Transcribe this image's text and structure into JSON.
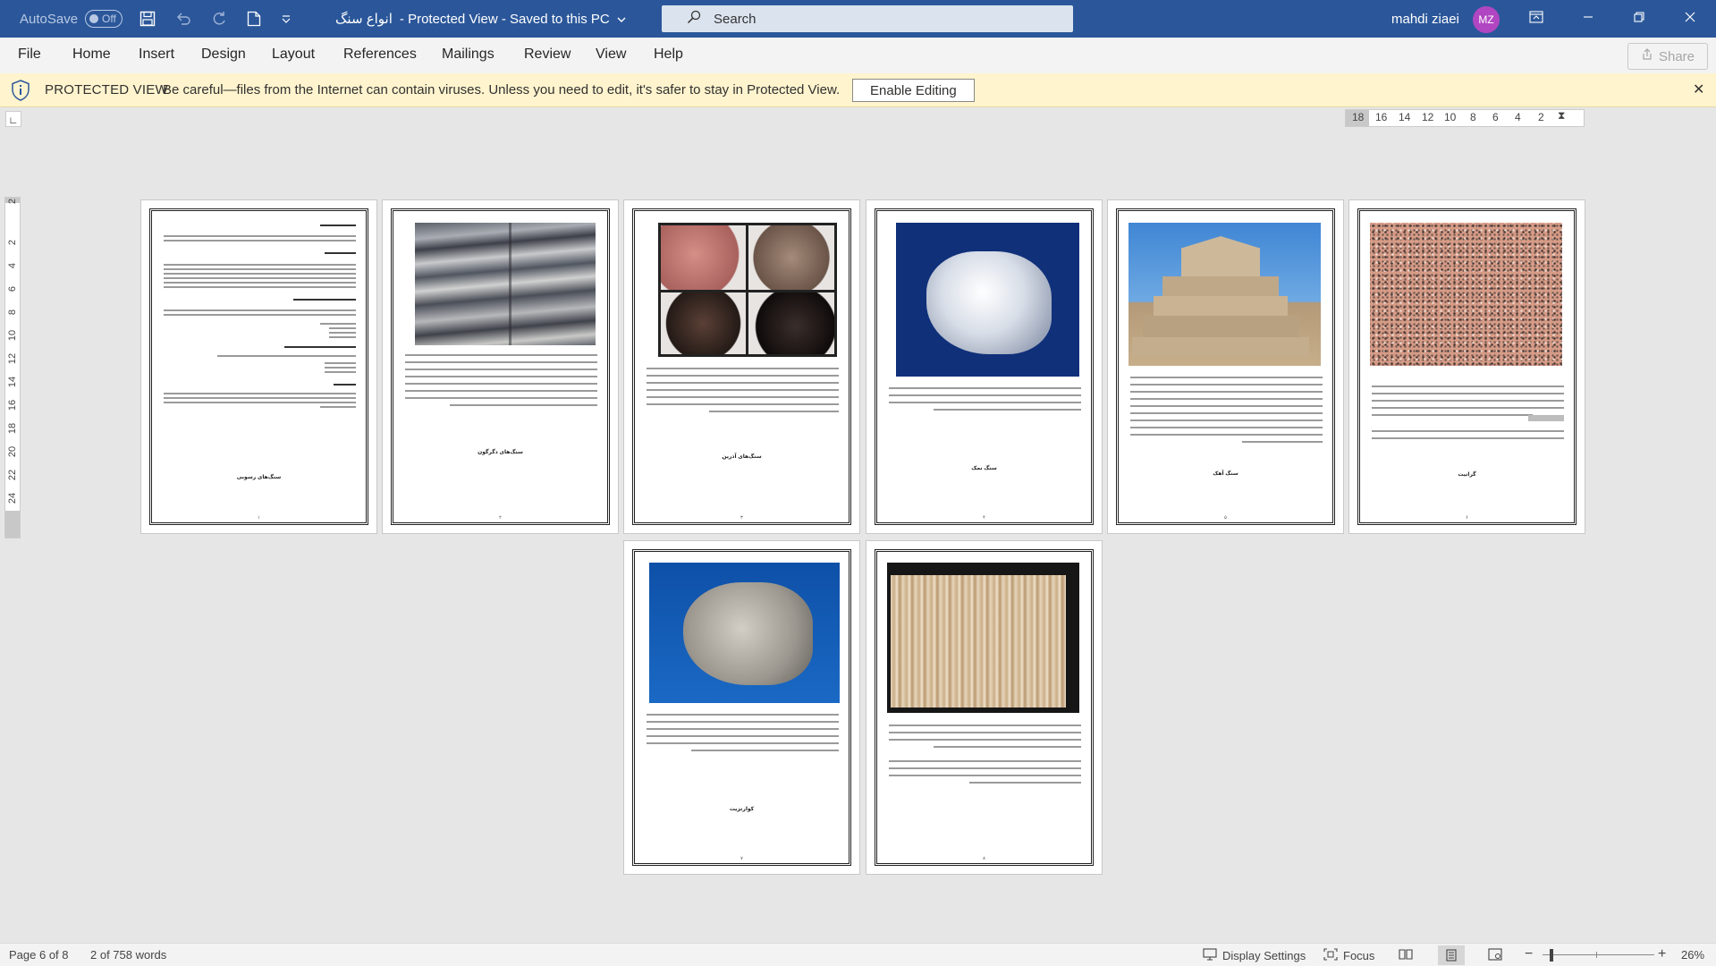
{
  "titlebar": {
    "autosave_label": "AutoSave",
    "autosave_state": "Off",
    "doc_name": "انواع سنگ",
    "doc_status": "-  Protected View  -  Saved to this PC",
    "search_placeholder": "Search",
    "user_name": "mahdi ziaei",
    "user_initials": "MZ",
    "brand_color": "#2b579a"
  },
  "ribbon": {
    "tabs": [
      "File",
      "Home",
      "Insert",
      "Design",
      "Layout",
      "References",
      "Mailings",
      "Review",
      "View",
      "Help"
    ],
    "share_label": "Share"
  },
  "protected_view": {
    "label": "PROTECTED VIEW",
    "message": "Be careful—files from the Internet can contain viruses. Unless you need to edit, it's safer to stay in Protected View.",
    "button": "Enable Editing",
    "bg_color": "#fff4ce"
  },
  "ruler": {
    "horizontal_ticks": [
      "18",
      "16",
      "14",
      "12",
      "10",
      "8",
      "6",
      "4",
      "2"
    ],
    "vertical_ticks": [
      "2",
      "2",
      "4",
      "6",
      "8",
      "10",
      "12",
      "14",
      "16",
      "18",
      "20",
      "22",
      "24"
    ]
  },
  "pages": [
    {
      "caption": "سنگ‌های رسوبی",
      "page_no": "۱"
    },
    {
      "caption": "سنگ‌های دگرگون",
      "page_no": "۲"
    },
    {
      "caption": "سنگ‌های آذرین",
      "page_no": "۳"
    },
    {
      "caption": "سنگ نمک",
      "page_no": "۴"
    },
    {
      "caption": "سنگ آهک",
      "page_no": "۵"
    },
    {
      "caption": "گرانیت",
      "page_no": "۶"
    },
    {
      "caption": "کوارتزیت",
      "page_no": "۷"
    },
    {
      "caption": "",
      "page_no": "۸"
    }
  ],
  "status": {
    "page": "Page 6 of 8",
    "words": "2 of 758 words",
    "display_settings": "Display Settings",
    "focus": "Focus",
    "zoom": "26%"
  }
}
